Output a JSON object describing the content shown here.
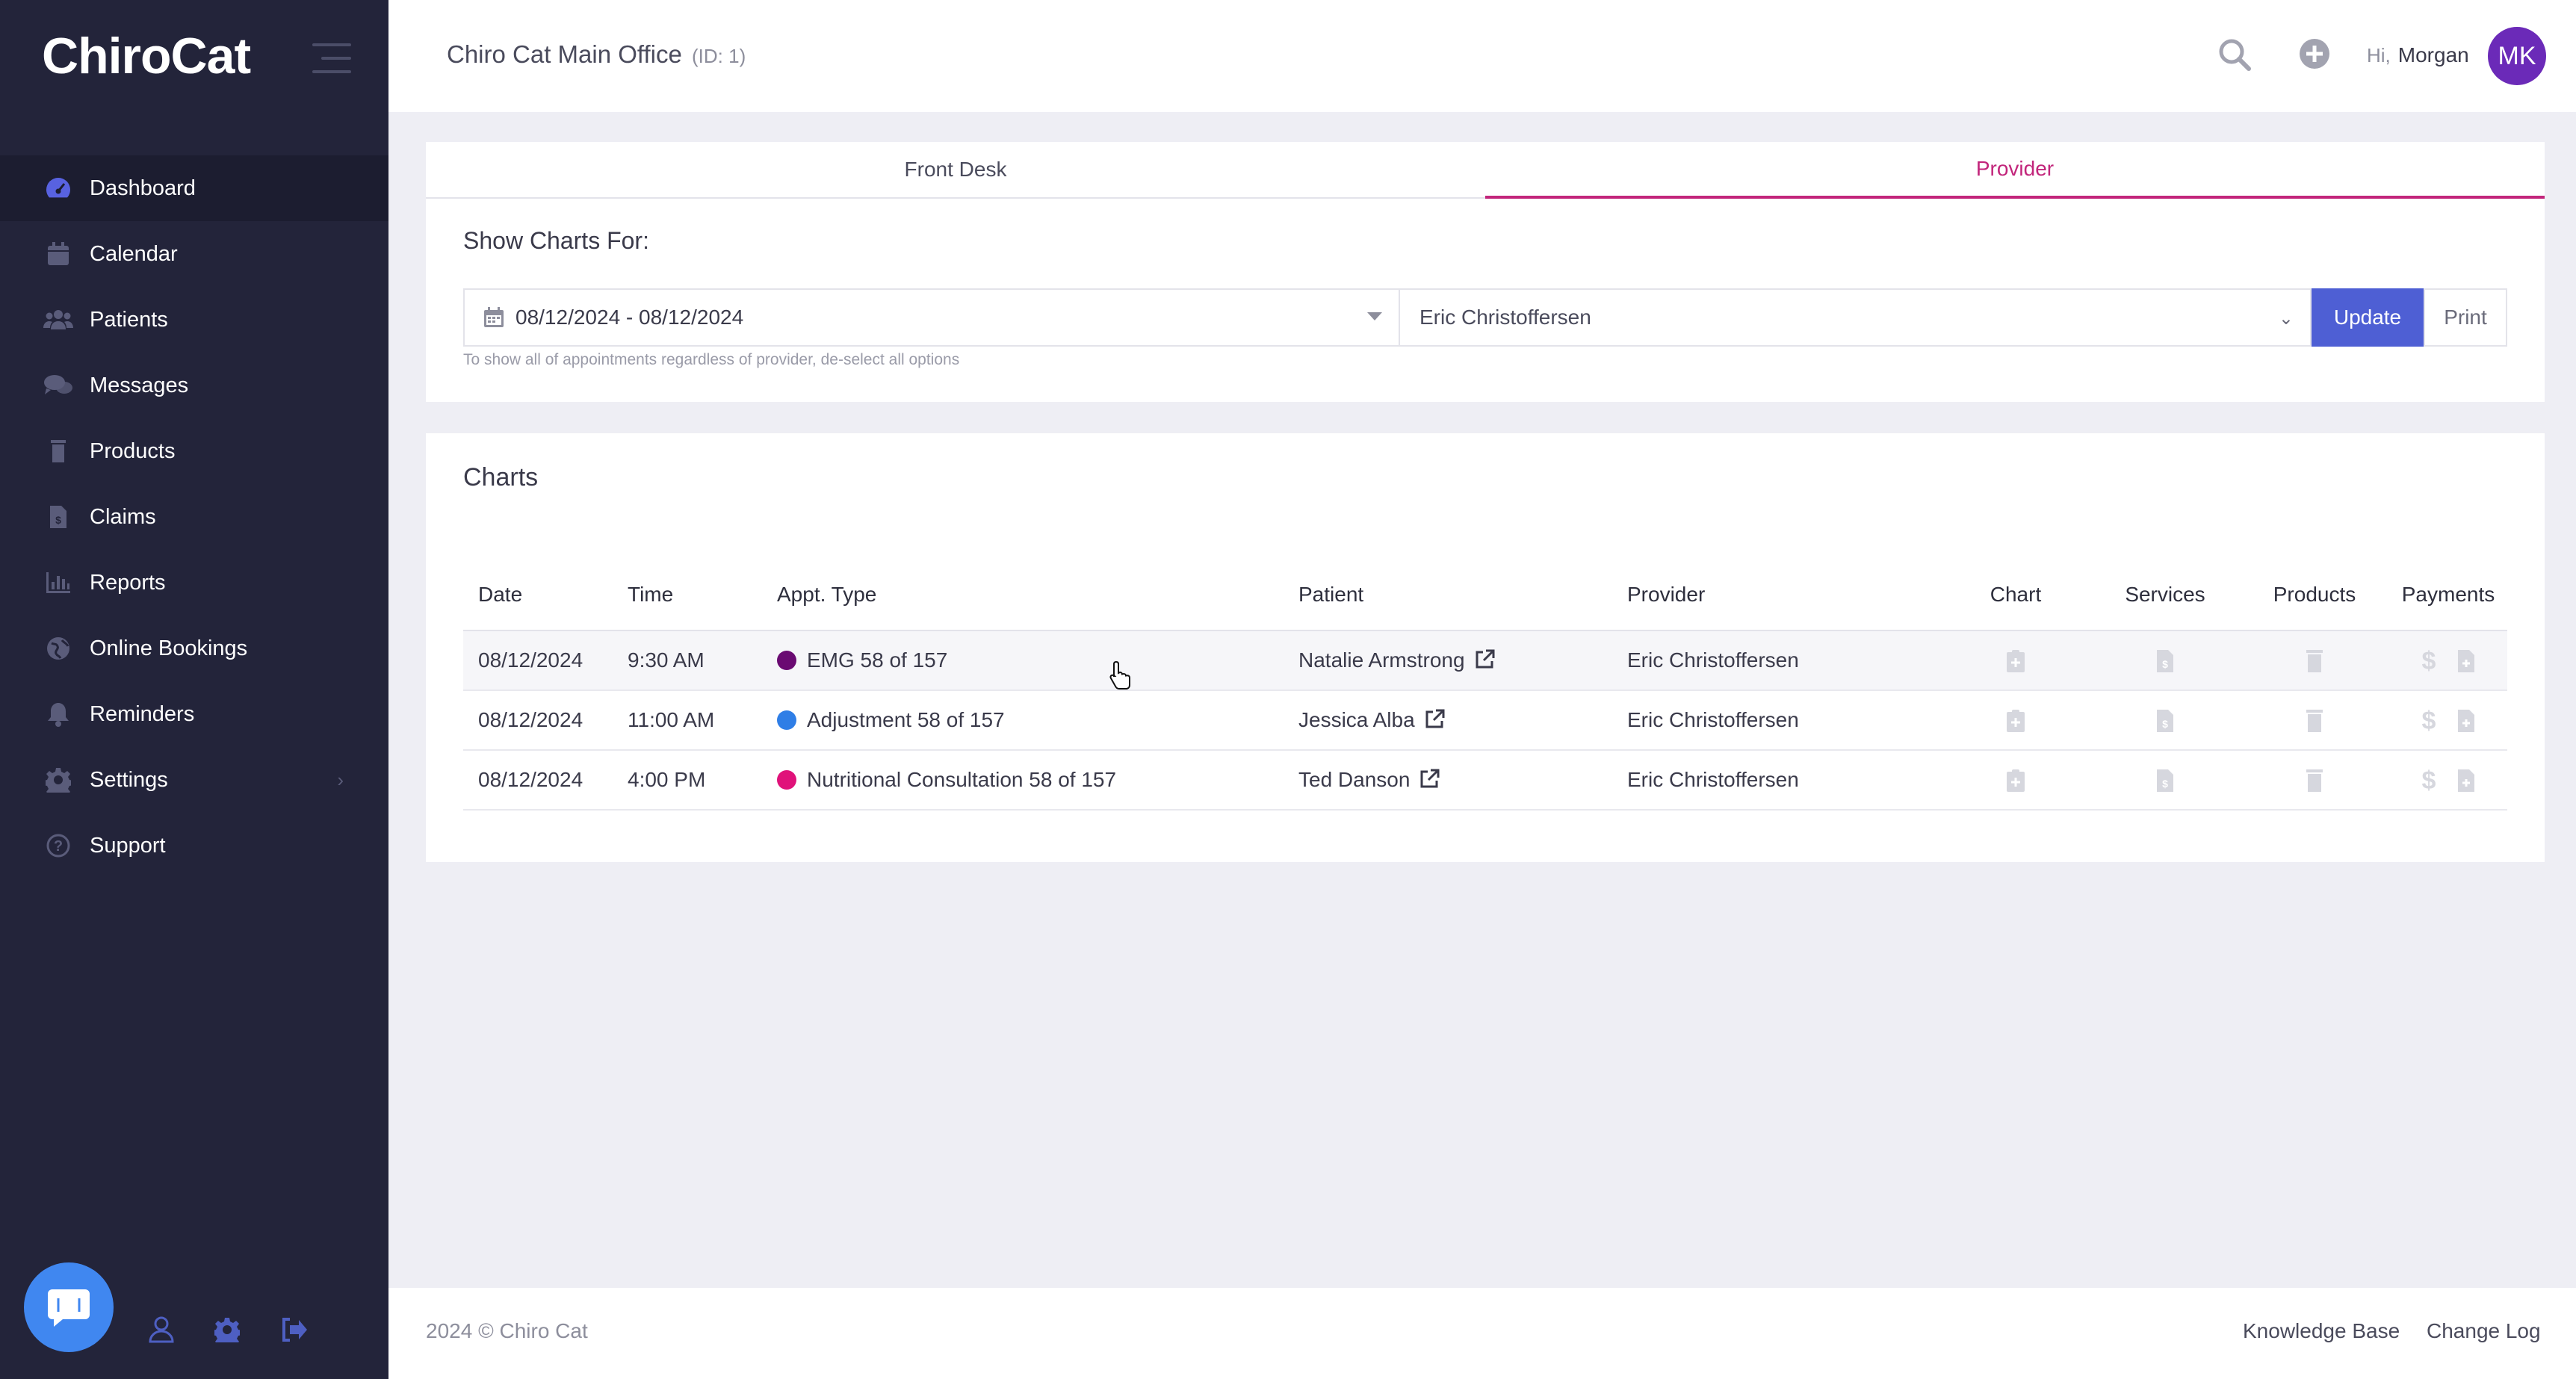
{
  "app": {
    "logo_text": "ChiroCat"
  },
  "sidebar": {
    "items": [
      {
        "label": "Dashboard",
        "icon": "dashboard-gauge-icon",
        "active": true
      },
      {
        "label": "Calendar",
        "icon": "calendar-icon"
      },
      {
        "label": "Patients",
        "icon": "users-icon"
      },
      {
        "label": "Messages",
        "icon": "chat-bubbles-icon"
      },
      {
        "label": "Products",
        "icon": "product-stack-icon"
      },
      {
        "label": "Claims",
        "icon": "claim-document-icon"
      },
      {
        "label": "Reports",
        "icon": "bar-chart-icon"
      },
      {
        "label": "Online Bookings",
        "icon": "globe-icon"
      },
      {
        "label": "Reminders",
        "icon": "bell-icon"
      },
      {
        "label": "Settings",
        "icon": "gear-icon",
        "has_submenu": true
      },
      {
        "label": "Support",
        "icon": "question-circle-icon"
      }
    ],
    "bottom_icons": [
      "chat-bubble-icon",
      "user-icon",
      "gear-icon",
      "logout-icon"
    ]
  },
  "header": {
    "office_name": "Chiro Cat Main Office",
    "office_id": "(ID: 1)",
    "greeting_hi": "Hi,",
    "user_name": "Morgan",
    "avatar_initials": "MK"
  },
  "tabs": [
    {
      "label": "Front Desk",
      "active": false
    },
    {
      "label": "Provider",
      "active": true
    }
  ],
  "filter": {
    "title": "Show Charts For:",
    "date_range": "08/12/2024 - 08/12/2024",
    "provider": "Eric Christoffersen",
    "update_label": "Update",
    "print_label": "Print",
    "hint": "To show all of appointments regardless of provider, de-select all options"
  },
  "charts": {
    "title": "Charts",
    "columns": [
      "Date",
      "Time",
      "Appt. Type",
      "Patient",
      "Provider",
      "Chart",
      "Services",
      "Products",
      "Payments"
    ],
    "rows": [
      {
        "date": "08/12/2024",
        "time": "9:30 AM",
        "appt_type": "EMG 58 of 157",
        "appt_color": "#6a0a72",
        "patient": "Natalie Armstrong",
        "provider": "Eric Christoffersen"
      },
      {
        "date": "08/12/2024",
        "time": "11:00 AM",
        "appt_type": "Adjustment 58 of 157",
        "appt_color": "#2f7ee6",
        "patient": "Jessica Alba",
        "provider": "Eric Christoffersen"
      },
      {
        "date": "08/12/2024",
        "time": "4:00 PM",
        "appt_type": "Nutritional Consultation 58 of 157",
        "appt_color": "#e0127a",
        "patient": "Ted Danson",
        "provider": "Eric Christoffersen"
      }
    ],
    "row_icons": {
      "payment_symbol": "$"
    }
  },
  "footer": {
    "copyright": "2024 © Chiro Cat",
    "knowledge_base": "Knowledge Base",
    "change_log": "Change Log"
  },
  "colors": {
    "sidebar_bg": "#23243a",
    "accent_blue": "#4e5fd4",
    "active_tab": "#c2257b",
    "avatar_bg": "#6b2ab8",
    "chat_bubble": "#4087f0"
  }
}
